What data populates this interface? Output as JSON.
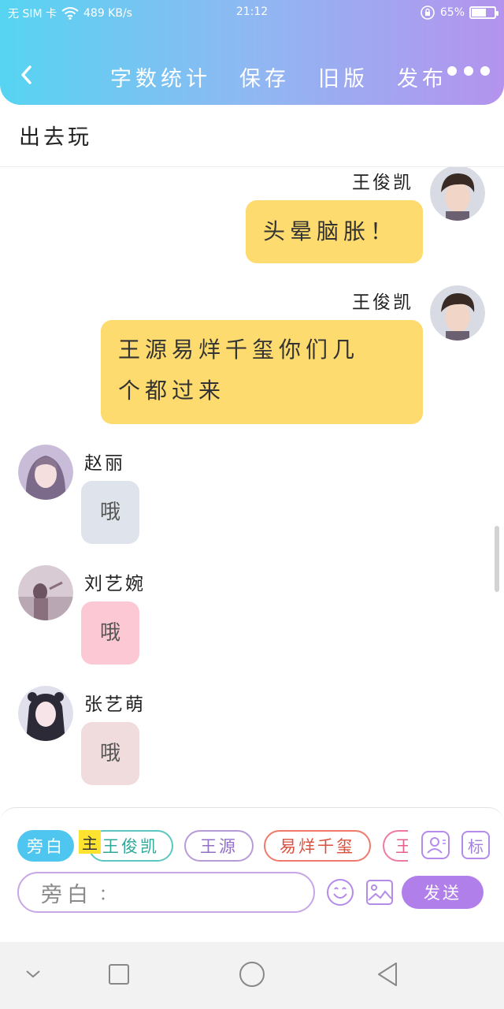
{
  "status_bar": {
    "carrier": "无 SIM 卡",
    "speed": "489 KB/s",
    "time": "21:12",
    "battery": "65%",
    "battery_level": 0.65
  },
  "nav": {
    "back_icon": "chevron-left-icon",
    "items": [
      "字数统计",
      "保存",
      "旧版",
      "发布"
    ],
    "more_icon": "more-horizontal-icon"
  },
  "story_title": "出去玩",
  "messages": [
    {
      "side": "right",
      "name": "王俊凯",
      "text": "头晕脑胀！"
    },
    {
      "side": "right",
      "name": "王俊凯",
      "text_line1": "王源易烊千玺你们几",
      "text_line2": "个都过来"
    },
    {
      "side": "left",
      "name": "赵丽",
      "text": "哦"
    },
    {
      "side": "left",
      "name": "刘艺婉",
      "text": "哦"
    },
    {
      "side": "left",
      "name": "张艺萌",
      "text": "哦"
    }
  ],
  "characters": {
    "narrator": "旁白",
    "main_badge": "主",
    "list": [
      "王俊凯",
      "王源",
      "易烊千玺",
      "王"
    ]
  },
  "input": {
    "placeholder": "旁白",
    "colon": "：",
    "mark_label": "标",
    "send_label": "发送"
  },
  "colors": {
    "header_start": "#56d4f2",
    "header_end": "#b493ee",
    "right_bubble": "#fedb6e",
    "bubble_zhaoli": "#dfe4ec",
    "bubble_liuyiwan": "#fbc8d3",
    "bubble_zhangyimeng": "#f1dcdd",
    "send_button": "#b17fe9"
  }
}
